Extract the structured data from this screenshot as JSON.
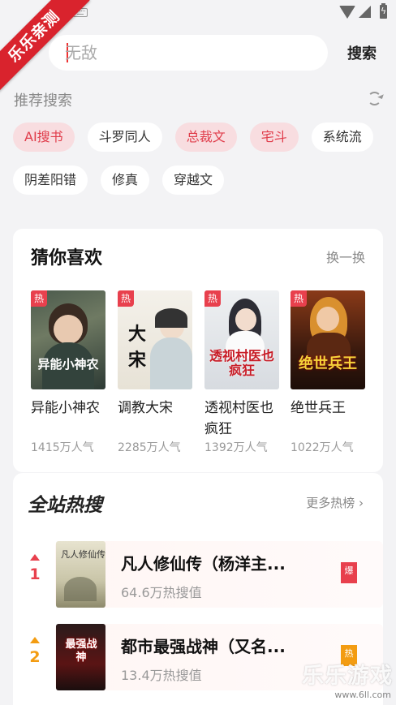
{
  "ribbon": {
    "text": "乐乐亲测"
  },
  "search": {
    "placeholder": "无敌",
    "button_label": "搜索"
  },
  "recommend": {
    "title": "推荐搜索",
    "chips": [
      {
        "label": "AI搜书",
        "hot": true
      },
      {
        "label": "斗罗同人",
        "hot": false
      },
      {
        "label": "总裁文",
        "hot": true
      },
      {
        "label": "宅斗",
        "hot": true
      },
      {
        "label": "系统流",
        "hot": false
      },
      {
        "label": "阴差阳错",
        "hot": false
      },
      {
        "label": "修真",
        "hot": false
      },
      {
        "label": "穿越文",
        "hot": false
      }
    ]
  },
  "guess": {
    "title": "猜你喜欢",
    "swap_label": "换一换",
    "hot_tag": "热",
    "books": [
      {
        "name": "异能小神农",
        "popularity": "1415万人气",
        "cover_text": "异能小神农"
      },
      {
        "name": "调教大宋",
        "popularity": "2285万人气",
        "cover_text": "大宋"
      },
      {
        "name": "透视村医也疯狂",
        "popularity": "1392万人气",
        "cover_text": "透视村医也疯狂"
      },
      {
        "name": "绝世兵王",
        "popularity": "1022万人气",
        "cover_text": "绝世兵王"
      }
    ]
  },
  "hot_search": {
    "title": "全站热搜",
    "more_label": "更多热榜",
    "items": [
      {
        "rank": "1",
        "name": "凡人修仙传（杨洋主...",
        "heat": "64.6万热搜值",
        "badge": "爆",
        "color": "#e8404d",
        "cover_text": "凡人修仙传"
      },
      {
        "rank": "2",
        "name": "都市最强战神（又名...",
        "heat": "13.4万热搜值",
        "badge": "热",
        "color": "#f39c12",
        "cover_text": "最强战神"
      }
    ]
  },
  "watermark": {
    "title": "乐乐游戏",
    "url": "www.6ll.com"
  }
}
